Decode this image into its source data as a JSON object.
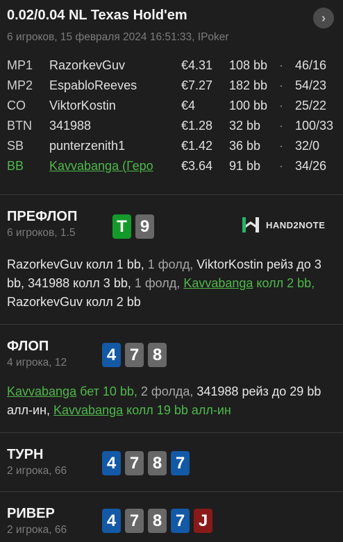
{
  "header": {
    "title": "0.02/0.04 NL Texas Hold'em",
    "subtitle": "6 игроков, 15 февраля 2024 16:51:33, IPoker",
    "next_label": "›"
  },
  "players": [
    {
      "pos": "MP1",
      "name": "RazorkevGuv",
      "stack": "€4.31",
      "bb": "108 bb",
      "stats": "46/16"
    },
    {
      "pos": "MP2",
      "name": "EspabloReeves",
      "stack": "€7.27",
      "bb": "182 bb",
      "stats": "54/23"
    },
    {
      "pos": "CO",
      "name": "ViktorKostin",
      "stack": "€4",
      "bb": "100 bb",
      "stats": "25/22"
    },
    {
      "pos": "BTN",
      "name": "341988",
      "stack": "€1.28",
      "bb": "32 bb",
      "stats": "100/33"
    },
    {
      "pos": "SB",
      "name": "punterzenith1",
      "stack": "€1.42",
      "bb": "36 bb",
      "stats": "32/0"
    },
    {
      "pos": "BB",
      "name": "Kavvabanga (Геро",
      "stack": "€3.64",
      "bb": "91 bb",
      "stats": "34/26"
    }
  ],
  "dot": "·",
  "logo": {
    "text": "HAND2NOTE"
  },
  "preflop": {
    "name": "ПРЕФЛОП",
    "sub": "6 игроков, 1.5",
    "cards": [
      "T",
      "9"
    ],
    "action": {
      "p1": "RazorkevGuv",
      "a1": " колл 1 bb, ",
      "f1": "1 фолд, ",
      "p2": "ViktorKostin",
      "a2": " рейз до 3 bb, ",
      "p3": "341988",
      "a3": " колл 3 bb, ",
      "f2": "1 фолд, ",
      "hero": "Kavvabanga",
      "ha": " колл 2 bb, ",
      "p4": "RazorkevGuv",
      "a4": " колл 2 bb"
    }
  },
  "flop": {
    "name": "ФЛОП",
    "sub": "4 игрока, 12",
    "cards": [
      "4",
      "7",
      "8"
    ],
    "action": {
      "hero1": "Kavvabanga",
      "ha1": " бет 10 bb, ",
      "f1": "2 фолда, ",
      "p1": "341988",
      "a1": " рейз до 29 bb алл-ин, ",
      "hero2": "Kavvabanga",
      "ha2": " колл 19 bb алл-ин"
    }
  },
  "turn": {
    "name": "ТУРН",
    "sub": "2 игрока, 66",
    "cards": [
      "4",
      "7",
      "8",
      "7"
    ]
  },
  "river": {
    "name": "РИВЕР",
    "sub": "2 игрока, 66",
    "cards": [
      "4",
      "7",
      "8",
      "7",
      "J"
    ]
  },
  "colors": {
    "background": "#1e1e1e",
    "hero": "#4fb84a",
    "card_spade_blue": "#1359a6",
    "card_grey": "#686868",
    "card_green": "#149a2a",
    "card_red": "#8a1a1a"
  }
}
